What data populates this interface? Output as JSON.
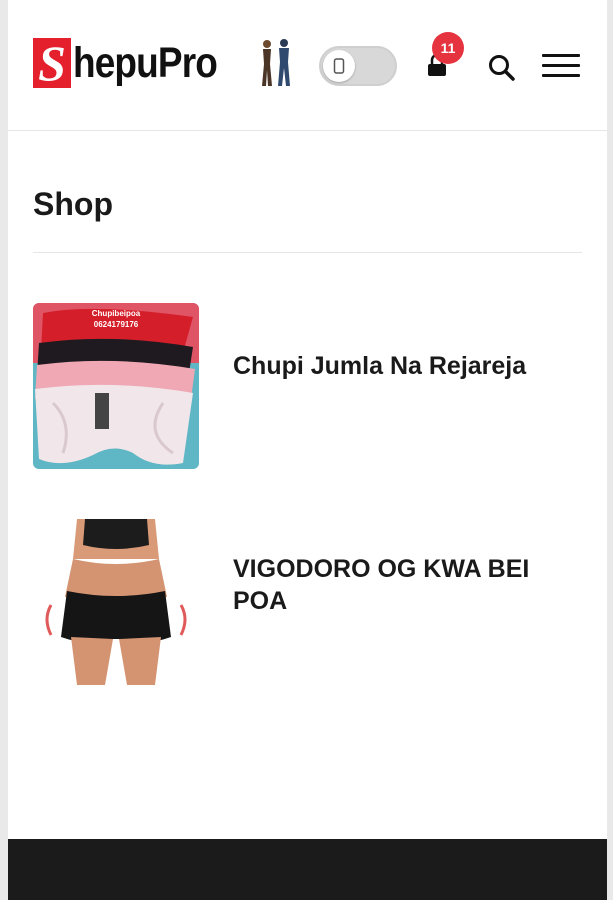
{
  "header": {
    "logo_text": "ShepuPro",
    "logo_letter": "S",
    "cart_count": "11",
    "icons": [
      "phone-icon",
      "cart-icon",
      "search-icon",
      "hamburger-menu-icon"
    ]
  },
  "page": {
    "title": "Shop"
  },
  "products": [
    {
      "name": "Chupi Jumla Na Rejareja",
      "image_caption": "Chupibeipoa\n0624179176"
    },
    {
      "name": "VIGODORO OG KWA BEI POA"
    }
  ],
  "colors": {
    "brand_red": "#e3202b",
    "badge_red": "#e53340",
    "text": "#1a1a1a",
    "footer": "#1b1b1b"
  }
}
